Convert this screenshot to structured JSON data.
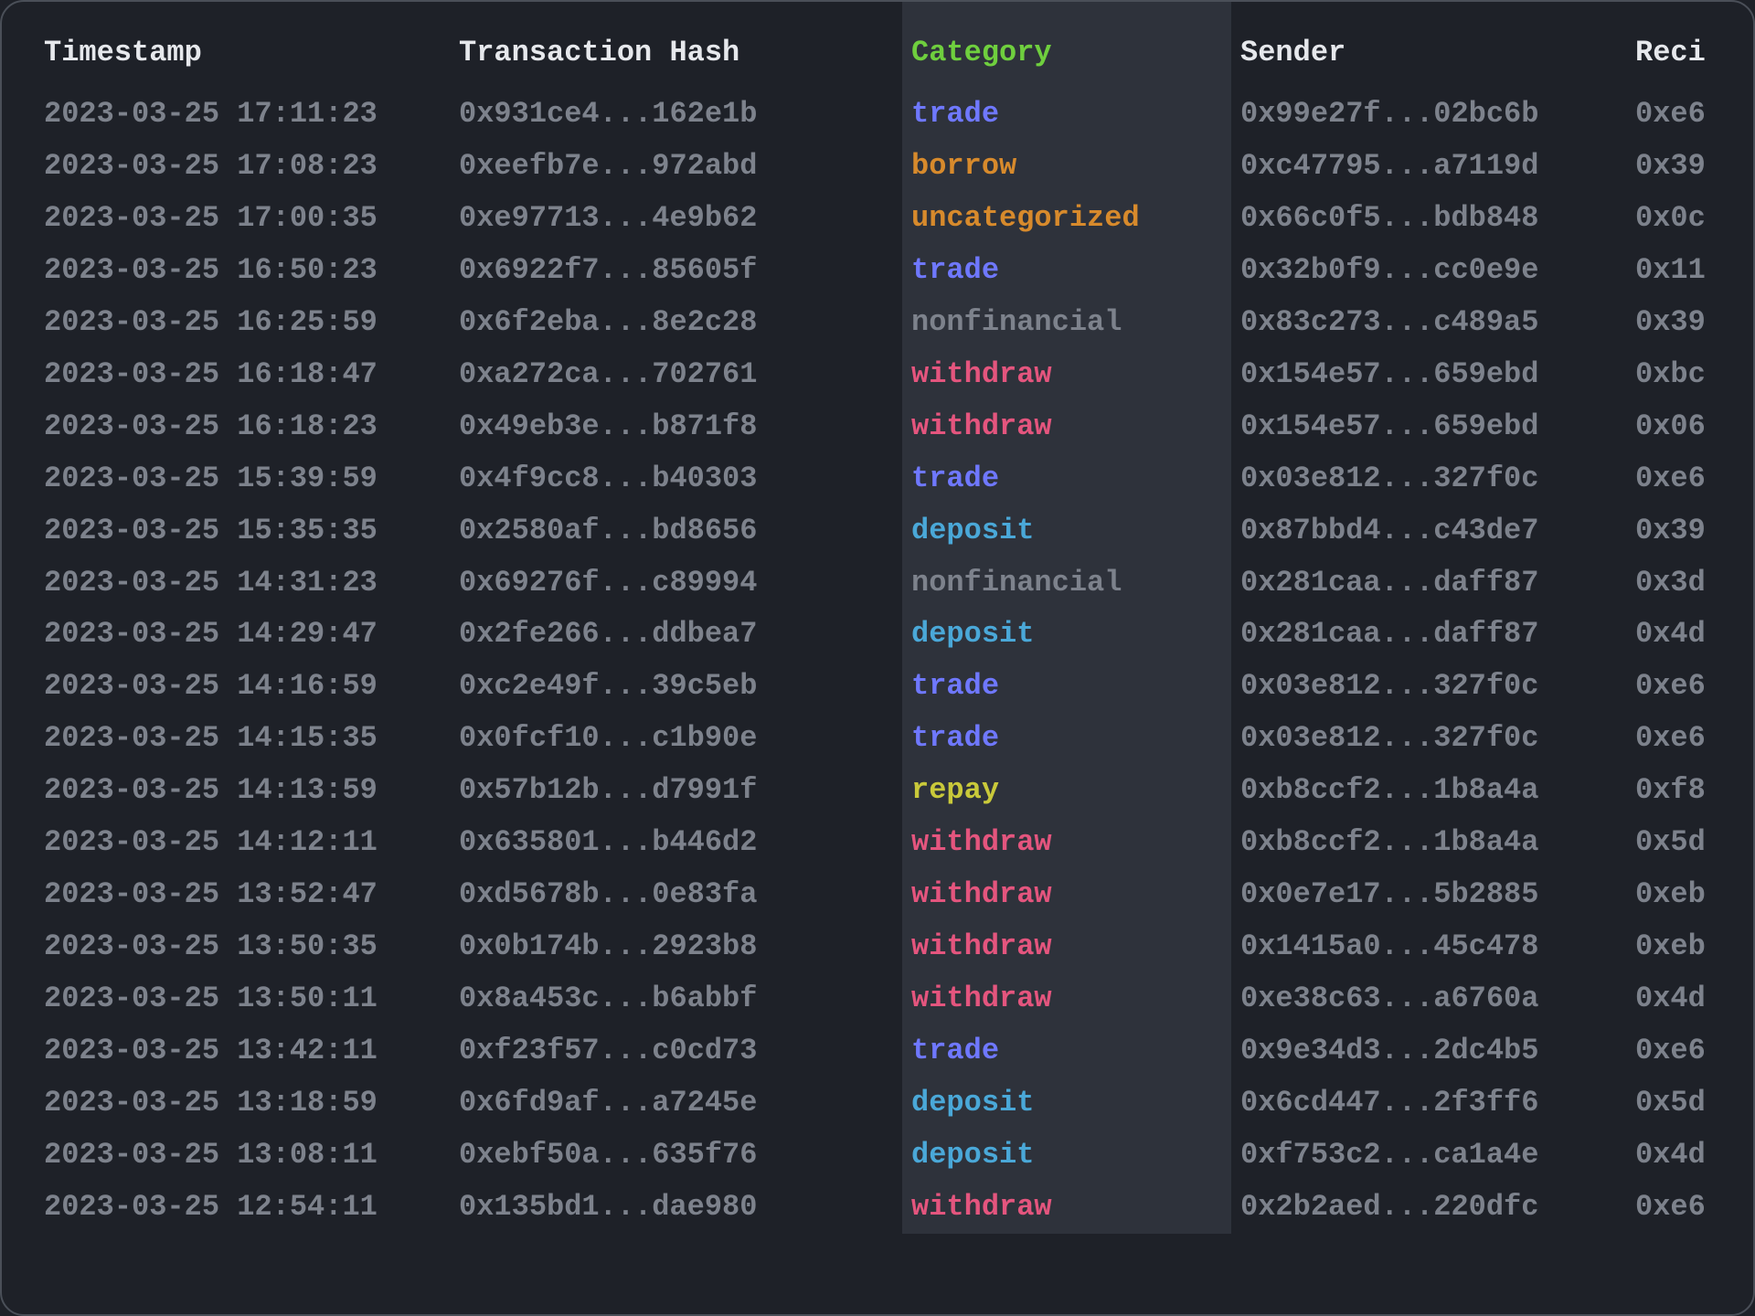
{
  "columns": {
    "timestamp": "Timestamp",
    "hash": "Transaction Hash",
    "category": "Category",
    "sender": "Sender",
    "recipient": "Reci"
  },
  "rows": [
    {
      "timestamp": "2023-03-25 17:11:23",
      "hash": "0x931ce4...162e1b",
      "category": "trade",
      "sender": "0x99e27f...02bc6b",
      "recipient": "0xe6"
    },
    {
      "timestamp": "2023-03-25 17:08:23",
      "hash": "0xeefb7e...972abd",
      "category": "borrow",
      "sender": "0xc47795...a7119d",
      "recipient": "0x39"
    },
    {
      "timestamp": "2023-03-25 17:00:35",
      "hash": "0xe97713...4e9b62",
      "category": "uncategorized",
      "sender": "0x66c0f5...bdb848",
      "recipient": "0x0c"
    },
    {
      "timestamp": "2023-03-25 16:50:23",
      "hash": "0x6922f7...85605f",
      "category": "trade",
      "sender": "0x32b0f9...cc0e9e",
      "recipient": "0x11"
    },
    {
      "timestamp": "2023-03-25 16:25:59",
      "hash": "0x6f2eba...8e2c28",
      "category": "nonfinancial",
      "sender": "0x83c273...c489a5",
      "recipient": "0x39"
    },
    {
      "timestamp": "2023-03-25 16:18:47",
      "hash": "0xa272ca...702761",
      "category": "withdraw",
      "sender": "0x154e57...659ebd",
      "recipient": "0xbc"
    },
    {
      "timestamp": "2023-03-25 16:18:23",
      "hash": "0x49eb3e...b871f8",
      "category": "withdraw",
      "sender": "0x154e57...659ebd",
      "recipient": "0x06"
    },
    {
      "timestamp": "2023-03-25 15:39:59",
      "hash": "0x4f9cc8...b40303",
      "category": "trade",
      "sender": "0x03e812...327f0c",
      "recipient": "0xe6"
    },
    {
      "timestamp": "2023-03-25 15:35:35",
      "hash": "0x2580af...bd8656",
      "category": "deposit",
      "sender": "0x87bbd4...c43de7",
      "recipient": "0x39"
    },
    {
      "timestamp": "2023-03-25 14:31:23",
      "hash": "0x69276f...c89994",
      "category": "nonfinancial",
      "sender": "0x281caa...daff87",
      "recipient": "0x3d"
    },
    {
      "timestamp": "2023-03-25 14:29:47",
      "hash": "0x2fe266...ddbea7",
      "category": "deposit",
      "sender": "0x281caa...daff87",
      "recipient": "0x4d"
    },
    {
      "timestamp": "2023-03-25 14:16:59",
      "hash": "0xc2e49f...39c5eb",
      "category": "trade",
      "sender": "0x03e812...327f0c",
      "recipient": "0xe6"
    },
    {
      "timestamp": "2023-03-25 14:15:35",
      "hash": "0x0fcf10...c1b90e",
      "category": "trade",
      "sender": "0x03e812...327f0c",
      "recipient": "0xe6"
    },
    {
      "timestamp": "2023-03-25 14:13:59",
      "hash": "0x57b12b...d7991f",
      "category": "repay",
      "sender": "0xb8ccf2...1b8a4a",
      "recipient": "0xf8"
    },
    {
      "timestamp": "2023-03-25 14:12:11",
      "hash": "0x635801...b446d2",
      "category": "withdraw",
      "sender": "0xb8ccf2...1b8a4a",
      "recipient": "0x5d"
    },
    {
      "timestamp": "2023-03-25 13:52:47",
      "hash": "0xd5678b...0e83fa",
      "category": "withdraw",
      "sender": "0x0e7e17...5b2885",
      "recipient": "0xeb"
    },
    {
      "timestamp": "2023-03-25 13:50:35",
      "hash": "0x0b174b...2923b8",
      "category": "withdraw",
      "sender": "0x1415a0...45c478",
      "recipient": "0xeb"
    },
    {
      "timestamp": "2023-03-25 13:50:11",
      "hash": "0x8a453c...b6abbf",
      "category": "withdraw",
      "sender": "0xe38c63...a6760a",
      "recipient": "0x4d"
    },
    {
      "timestamp": "2023-03-25 13:42:11",
      "hash": "0xf23f57...c0cd73",
      "category": "trade",
      "sender": "0x9e34d3...2dc4b5",
      "recipient": "0xe6"
    },
    {
      "timestamp": "2023-03-25 13:18:59",
      "hash": "0x6fd9af...a7245e",
      "category": "deposit",
      "sender": "0x6cd447...2f3ff6",
      "recipient": "0x5d"
    },
    {
      "timestamp": "2023-03-25 13:08:11",
      "hash": "0xebf50a...635f76",
      "category": "deposit",
      "sender": "0xf753c2...ca1a4e",
      "recipient": "0x4d"
    },
    {
      "timestamp": "2023-03-25 12:54:11",
      "hash": "0x135bd1...dae980",
      "category": "withdraw",
      "sender": "0x2b2aed...220dfc",
      "recipient": "0xe6"
    }
  ]
}
